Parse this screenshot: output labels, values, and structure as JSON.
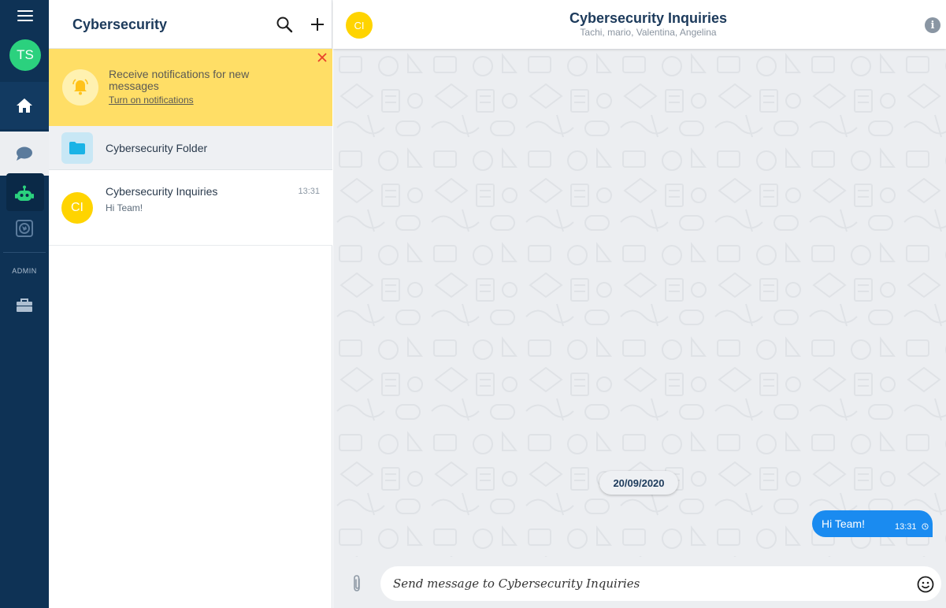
{
  "user": {
    "initials": "TS",
    "avatar_color": "#2bd17e"
  },
  "rail": {
    "admin_label": "ADMIN",
    "items": [
      {
        "icon": "home-icon"
      },
      {
        "icon": "chat-bubble-icon"
      },
      {
        "icon": "robot-icon",
        "selected": true
      },
      {
        "icon": "globe-icon"
      },
      {
        "icon": "toolbox-icon"
      }
    ]
  },
  "sidebar": {
    "title": "Cybersecurity",
    "notification": {
      "text": "Receive notifications for new messages",
      "link": "Turn on notifications"
    },
    "folder": {
      "label": "Cybersecurity Folder"
    },
    "conversations": [
      {
        "initials": "CI",
        "name": "Cybersecurity Inquiries",
        "preview": "Hi Team!",
        "time": "13:31"
      }
    ]
  },
  "chat": {
    "initials": "CI",
    "title": "Cybersecurity Inquiries",
    "members": "Tachi, mario, Valentina, Angelina",
    "date_separator": "20/09/2020",
    "messages": [
      {
        "text": "Hi Team!",
        "time": "13:31",
        "outgoing": true
      }
    ],
    "composer": {
      "placeholder": "Send message to Cybersecurity Inquiries"
    }
  },
  "colors": {
    "rail_bg": "#0e3255",
    "accent": "#1a8bf0",
    "notification_bg": "#ffde66",
    "room_avatar": "#ffd400",
    "bot_icon": "#2bd17e"
  }
}
